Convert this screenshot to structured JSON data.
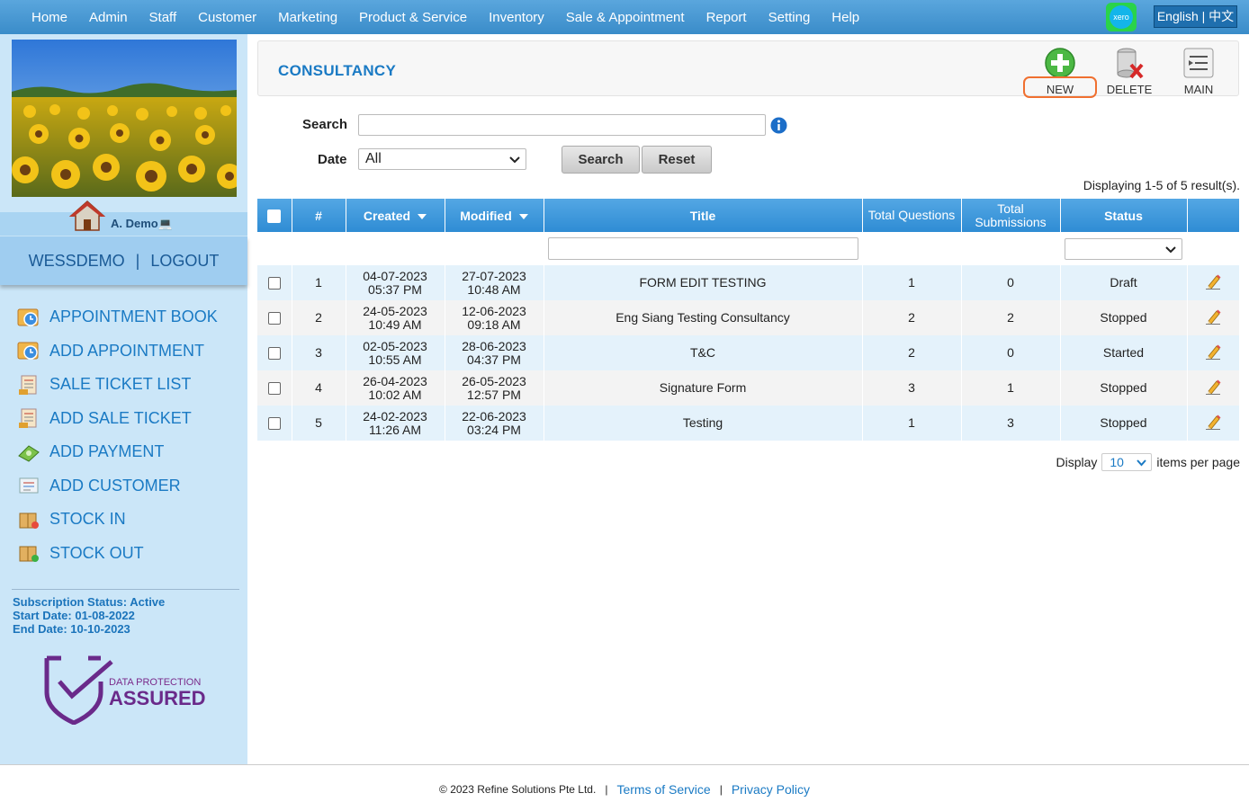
{
  "topnav": {
    "items": [
      "Home",
      "Admin",
      "Staff",
      "Customer",
      "Marketing",
      "Product & Service",
      "Inventory",
      "Sale & Appointment",
      "Report",
      "Setting",
      "Help"
    ],
    "xero_label": "xero",
    "language_label": "English | 中文"
  },
  "sidebar": {
    "user_name": "A. Demo",
    "account_name": "WESSDEMO",
    "separator": "|",
    "logout_label": "LOGOUT",
    "quick_links": [
      {
        "label": "APPOINTMENT BOOK",
        "icon": "appointment-book-icon"
      },
      {
        "label": "ADD APPOINTMENT",
        "icon": "add-appointment-icon"
      },
      {
        "label": "SALE TICKET LIST",
        "icon": "sale-ticket-list-icon"
      },
      {
        "label": "ADD SALE TICKET",
        "icon": "add-sale-ticket-icon"
      },
      {
        "label": "ADD PAYMENT",
        "icon": "add-payment-icon"
      },
      {
        "label": "ADD CUSTOMER",
        "icon": "add-customer-icon"
      },
      {
        "label": "STOCK IN",
        "icon": "stock-in-icon"
      },
      {
        "label": "STOCK OUT",
        "icon": "stock-out-icon"
      }
    ],
    "subscription_status": "Subscription Status: Active",
    "start_date": "Start Date: 01-08-2022",
    "end_date": "End Date: 10-10-2023",
    "badge_line1": "DATA PROTECTION",
    "badge_line2": "ASSURED"
  },
  "page": {
    "title": "CONSULTANCY",
    "toolbar": {
      "new_label": "NEW",
      "delete_label": "DELETE",
      "main_label": "MAIN"
    },
    "search_label": "Search",
    "search_value": "",
    "date_label": "Date",
    "date_value": "All",
    "search_button": "Search",
    "reset_button": "Reset",
    "displaying": "Displaying 1-5 of 5 result(s)."
  },
  "table": {
    "headers": [
      "#",
      "Created",
      "Modified",
      "Title",
      "Total Questions",
      "Total Submissions",
      "Status"
    ],
    "rows": [
      {
        "num": "1",
        "created_date": "04-07-2023",
        "created_time": "05:37 PM",
        "modified_date": "27-07-2023",
        "modified_time": "10:48 AM",
        "title": "FORM EDIT TESTING",
        "questions": "1",
        "submissions": "0",
        "status": "Draft"
      },
      {
        "num": "2",
        "created_date": "24-05-2023",
        "created_time": "10:49 AM",
        "modified_date": "12-06-2023",
        "modified_time": "09:18 AM",
        "title": "Eng Siang Testing Consultancy",
        "questions": "2",
        "submissions": "2",
        "status": "Stopped"
      },
      {
        "num": "3",
        "created_date": "02-05-2023",
        "created_time": "10:55 AM",
        "modified_date": "28-06-2023",
        "modified_time": "04:37 PM",
        "title": "T&C",
        "questions": "2",
        "submissions": "0",
        "status": "Started"
      },
      {
        "num": "4",
        "created_date": "26-04-2023",
        "created_time": "10:02 AM",
        "modified_date": "26-05-2023",
        "modified_time": "12:57 PM",
        "title": "Signature Form",
        "questions": "3",
        "submissions": "1",
        "status": "Stopped"
      },
      {
        "num": "5",
        "created_date": "24-02-2023",
        "created_time": "11:26 AM",
        "modified_date": "22-06-2023",
        "modified_time": "03:24 PM",
        "title": "Testing",
        "questions": "1",
        "submissions": "3",
        "status": "Stopped"
      }
    ]
  },
  "pagination": {
    "display_label": "Display",
    "per_page_value": "10",
    "suffix": "items per page"
  },
  "footer": {
    "copyright": "© 2023 Refine Solutions Pte Ltd.",
    "sep": "|",
    "terms": "Terms of Service",
    "privacy": "Privacy Policy"
  },
  "colors": {
    "nav": "#3a8cc9",
    "accent": "#1a7ac4",
    "sidebar": "#cbe6f8",
    "highlight_ring": "#f07030"
  }
}
